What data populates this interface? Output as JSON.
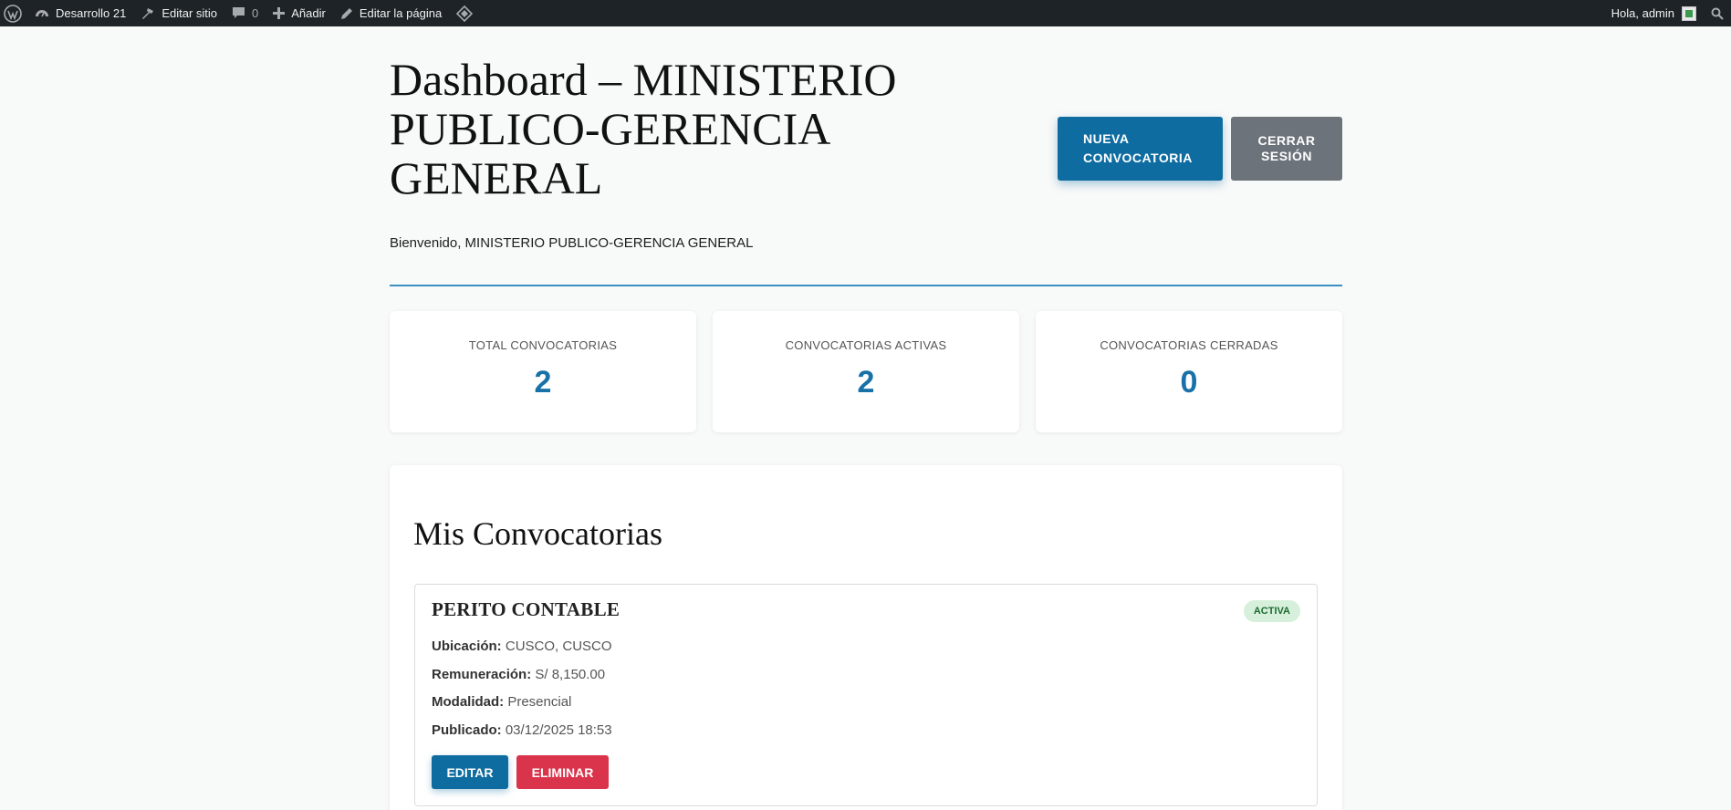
{
  "adminbar": {
    "site_name": "Desarrollo 21",
    "edit_site": "Editar sitio",
    "comments_count": "0",
    "add_new": "Añadir",
    "edit_page": "Editar la página",
    "greeting": "Hola, admin"
  },
  "header": {
    "title": "Dashboard – MINISTERIO PUBLICO-GERENCIA GENERAL",
    "new_button": "NUEVA CONVOCATORIA",
    "logout_button": "CERRAR SESIÓN",
    "welcome": "Bienvenido, MINISTERIO PUBLICO-GERENCIA GENERAL"
  },
  "stats": [
    {
      "label": "TOTAL CONVOCATORIAS",
      "value": "2"
    },
    {
      "label": "CONVOCATORIAS ACTIVAS",
      "value": "2"
    },
    {
      "label": "CONVOCATORIAS CERRADAS",
      "value": "0"
    }
  ],
  "panel": {
    "title": "Mis Convocatorias",
    "items": [
      {
        "title": "PERITO CONTABLE",
        "status": "ACTIVA",
        "location_label": "Ubicación:",
        "location": "CUSCO, CUSCO",
        "salary_label": "Remuneración:",
        "salary": "S/ 8,150.00",
        "modality_label": "Modalidad:",
        "modality": "Presencial",
        "published_label": "Publicado:",
        "published": "03/12/2025 18:53",
        "edit_button": "EDITAR",
        "delete_button": "ELIMINAR"
      }
    ]
  },
  "colors": {
    "primary": "#0e6ca0",
    "secondary": "#6c737b",
    "danger": "#d9344b",
    "stat_value": "#1872a8",
    "status_bg": "#d7f0dc"
  },
  "icons": [
    "wordpress-icon",
    "dashboard-icon",
    "hammer-icon",
    "comment-icon",
    "plus-icon",
    "pencil-icon",
    "diamond-icon",
    "search-icon"
  ]
}
